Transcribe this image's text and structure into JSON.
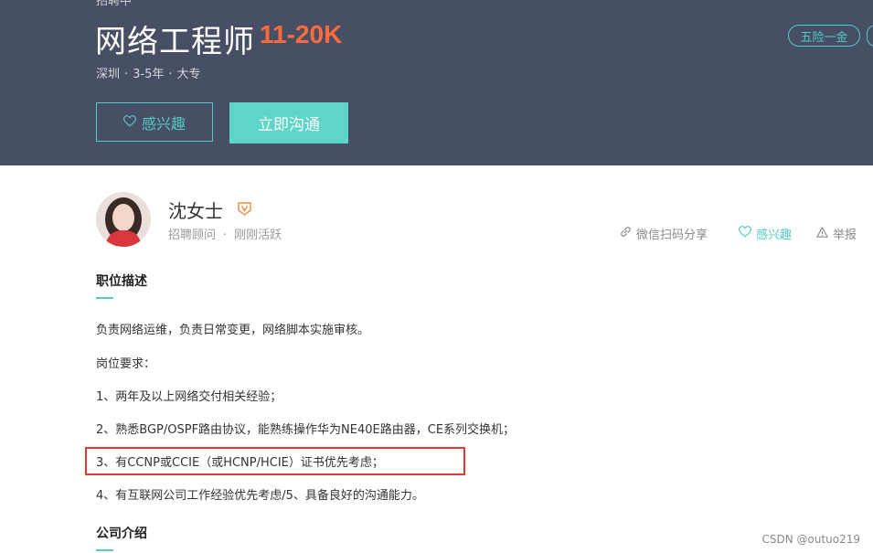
{
  "hero": {
    "cut_text": "招聘中",
    "job_title": "网络工程师",
    "salary": "11-20K",
    "meta": {
      "city": "深圳",
      "experience": "3-5年",
      "education": "大专",
      "separator": "·"
    },
    "interest_button": "感兴趣",
    "chat_button": "立即沟通",
    "benefit_tag": "五险一金"
  },
  "recruiter": {
    "name": "沈女士",
    "title": "招聘顾问",
    "separator": "·",
    "status": "刚刚活跃"
  },
  "actions": {
    "share": "微信扫码分享",
    "interest": "感兴趣",
    "report": "举报"
  },
  "job_description": {
    "heading": "职位描述",
    "lines": [
      "负责网络运维，负责日常变更，网络脚本实施审核。",
      "岗位要求：",
      "1、两年及以上网络交付相关经验；",
      "2、熟悉BGP/OSPF路由协议，能熟练操作华为NE40E路由器，CE系列交换机；",
      "3、有CCNP或CCIE（或HCNP/HCIE）证书优先考虑；",
      "4、有互联网公司工作经验优先考虑/5、具备良好的沟通能力。"
    ]
  },
  "company_section": {
    "heading": "公司介绍"
  },
  "watermark": "CSDN @outuo219",
  "colors": {
    "header_bg": "#474f64",
    "accent": "#53cac3",
    "salary": "#ff6b3d",
    "highlight": "#e53935"
  }
}
